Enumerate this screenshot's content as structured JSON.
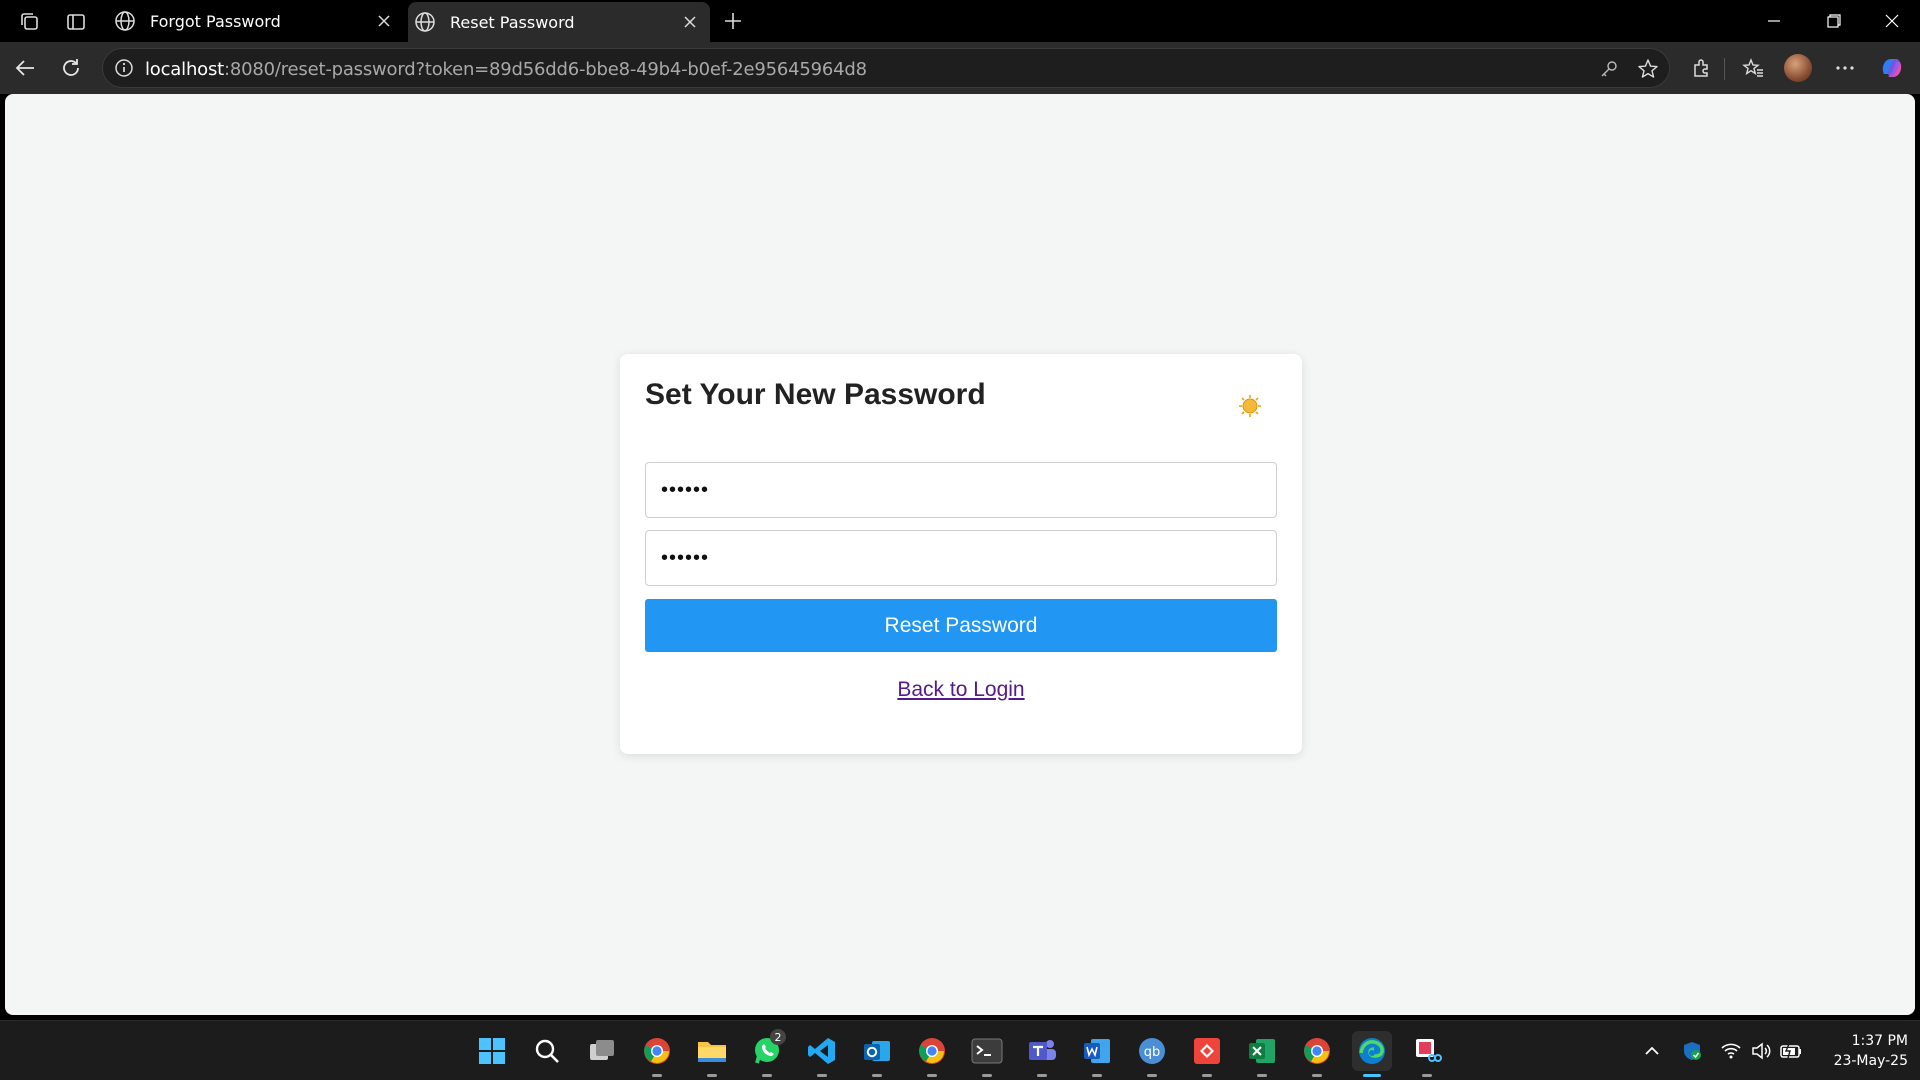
{
  "browser": {
    "tabs": [
      {
        "title": "Forgot Password",
        "active": false
      },
      {
        "title": "Reset Password",
        "active": true
      }
    ],
    "address": {
      "host": "localhost",
      "rest": ":8080/reset-password?token=89d56dd6-bbe8-49b4-b0ef-2e95645964d8"
    }
  },
  "page": {
    "heading": "Set Your New Password",
    "new_password_value": "••••••",
    "confirm_password_value": "••••••",
    "reset_button_label": "Reset Password",
    "back_link_label": "Back to Login",
    "colors": {
      "accent": "#2196f3",
      "link": "#551a8b",
      "background": "#f4f6f5",
      "sun_icon": "#f0a30a"
    }
  },
  "taskbar": {
    "apps": [
      "windows-start",
      "search",
      "task-view",
      "chrome-profile-1",
      "file-explorer",
      "whatsapp",
      "vscode",
      "outlook",
      "chrome-profile-2",
      "terminal",
      "teams",
      "word",
      "qbittorrent",
      "anydesk",
      "excel",
      "chrome-profile-3",
      "edge",
      "snipping-tool"
    ],
    "whatsapp_badge": "2",
    "clock": {
      "time": "1:37 PM",
      "date": "23-May-25"
    }
  }
}
